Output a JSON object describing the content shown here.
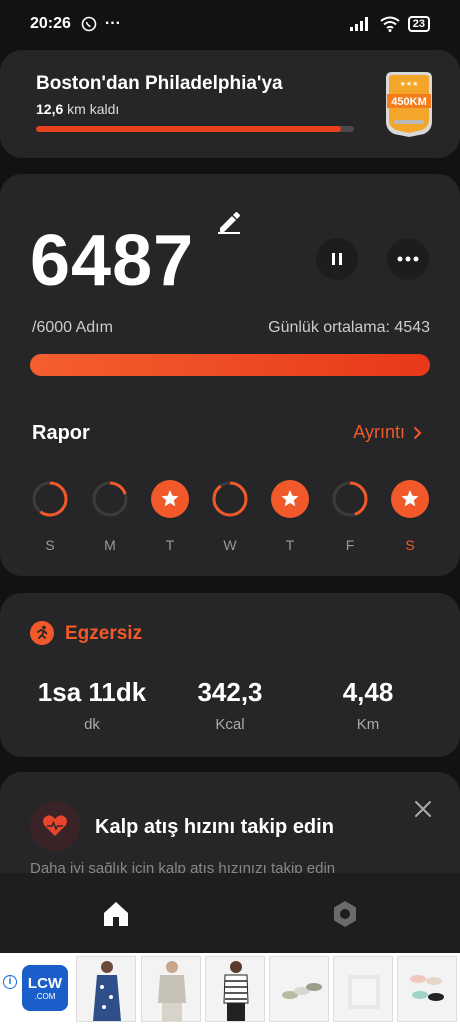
{
  "status_bar": {
    "time": "20:26",
    "battery": "23"
  },
  "route": {
    "title": "Boston'dan Philadelphia'ya",
    "remaining_value": "12,6",
    "remaining_suffix": "km kaldı",
    "progress": 0.96,
    "medal_label": "450KM",
    "accent": "#e8401c"
  },
  "steps": {
    "value": "6487",
    "goal": "/6000 Adım",
    "daily_average": "Günlük ortalama: 4543",
    "progress": 1.0
  },
  "report": {
    "title": "Rapor",
    "link": "Ayrıntı",
    "days": [
      {
        "label": "S",
        "progress": 0.6,
        "goal_met": false,
        "today": false
      },
      {
        "label": "M",
        "progress": 0.2,
        "goal_met": false,
        "today": false
      },
      {
        "label": "T",
        "progress": 1.0,
        "goal_met": true,
        "today": false
      },
      {
        "label": "W",
        "progress": 0.9,
        "goal_met": false,
        "today": false
      },
      {
        "label": "T",
        "progress": 1.0,
        "goal_met": true,
        "today": false
      },
      {
        "label": "F",
        "progress": 0.45,
        "goal_met": false,
        "today": false
      },
      {
        "label": "S",
        "progress": 1.0,
        "goal_met": true,
        "today": true
      }
    ]
  },
  "exercise": {
    "title": "Egzersiz",
    "stats": [
      {
        "value": "1sa 11dk",
        "unit": "dk"
      },
      {
        "value": "342,3",
        "unit": "Kcal"
      },
      {
        "value": "4,48",
        "unit": "Km"
      }
    ]
  },
  "heart": {
    "title": "Kalp atış hızını takip edin",
    "description": "Daha iyi sağlık için kalp atış hızınızı takip edin"
  },
  "ad": {
    "logo_big": "LCW",
    "logo_small": ".COM"
  },
  "colors": {
    "accent": "#f2592a",
    "card": "#262628",
    "background": "#121212"
  },
  "icons": [
    "whatsapp-icon",
    "signal-icon",
    "wifi-icon",
    "battery-icon",
    "medal-icon",
    "edit-icon",
    "pause-icon",
    "more-icon",
    "chevron-right-icon",
    "star-icon",
    "run-icon",
    "heart-icon",
    "close-icon",
    "home-icon",
    "settings-icon",
    "info-icon"
  ]
}
